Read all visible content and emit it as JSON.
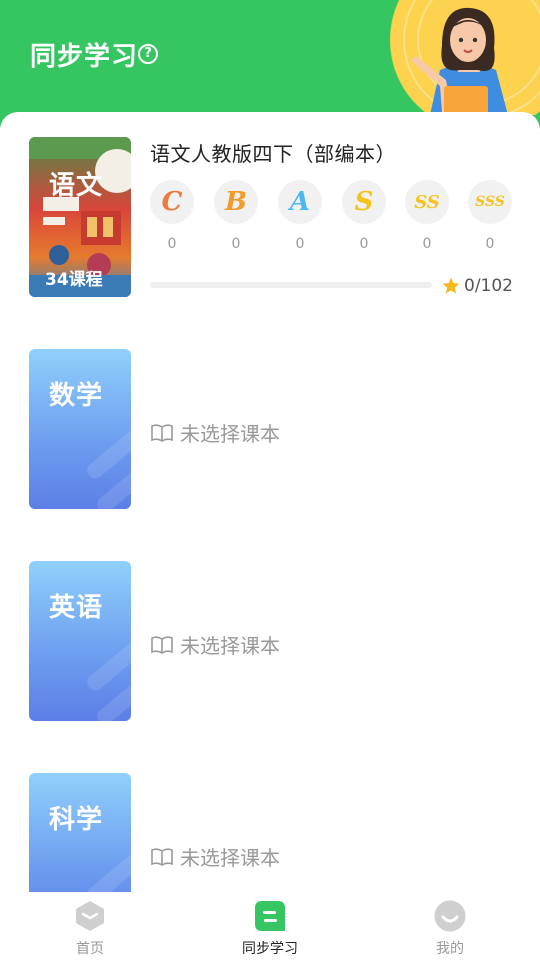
{
  "header": {
    "title": "同步学习",
    "help_icon": "?"
  },
  "subjects": [
    {
      "cover_label": "语文",
      "cover_lessons": "34课程",
      "book_title": "语文人教版四下（部编本）",
      "grades": [
        {
          "letter": "C",
          "count": "0",
          "color": "#f07a3c"
        },
        {
          "letter": "B",
          "count": "0",
          "color": "#f39a2a"
        },
        {
          "letter": "A",
          "count": "0",
          "color": "#4fb7f0"
        },
        {
          "letter": "S",
          "count": "0",
          "color": "#f6c31a"
        },
        {
          "letter": "SS",
          "count": "0",
          "color": "#f6c31a"
        },
        {
          "letter": "SSS",
          "count": "0",
          "color": "#f6c31a"
        }
      ],
      "progress": "0/102",
      "progress_fraction": 0
    },
    {
      "cover_label": "数学",
      "empty_text": "未选择课本"
    },
    {
      "cover_label": "英语",
      "empty_text": "未选择课本"
    },
    {
      "cover_label": "科学",
      "empty_text": "未选择课本"
    }
  ],
  "tabbar": {
    "items": [
      {
        "label": "首页",
        "icon": "home-icon",
        "active": false
      },
      {
        "label": "同步学习",
        "icon": "sync-study-icon",
        "active": true
      },
      {
        "label": "我的",
        "icon": "profile-icon",
        "active": false
      }
    ]
  },
  "colors": {
    "brand_green": "#36c661",
    "cover_blue": "#6d9cef",
    "star": "#f6b81a"
  }
}
